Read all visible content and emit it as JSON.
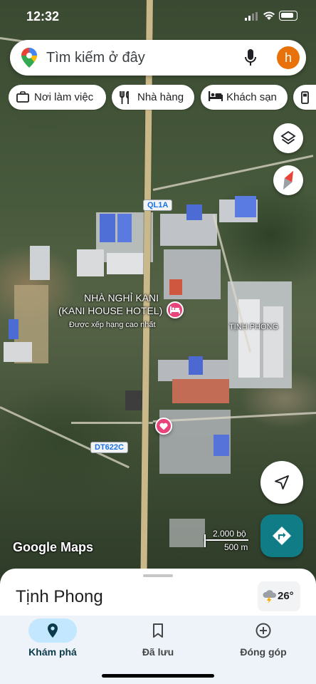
{
  "status_bar": {
    "time": "12:32"
  },
  "search": {
    "placeholder": "Tìm kiếm ở đây",
    "avatar_letter": "h"
  },
  "chips": [
    {
      "label": "Nơi làm việc",
      "icon": "briefcase-icon"
    },
    {
      "label": "Nhà hàng",
      "icon": "restaurant-icon"
    },
    {
      "label": "Khách sạn",
      "icon": "hotel-icon"
    },
    {
      "label": "",
      "icon": "gas-station-icon"
    }
  ],
  "map": {
    "road_shields": {
      "ql1a": "QL1A",
      "dt622c": "DT622C"
    },
    "hotel_name_1": "NHÀ NGHỈ KANI",
    "hotel_name_2": "(KANI HOUSE HOTEL)",
    "hotel_subtitle": "Được xếp hạng cao nhất",
    "area_label": "TỊNH PHONG",
    "google_logo": "Google Maps",
    "scale_imperial": "2.000 bộ",
    "scale_metric": "500 m"
  },
  "sheet": {
    "place_name": "Tịnh Phong",
    "temperature": "26°"
  },
  "nav": {
    "tabs": [
      {
        "label": "Khám phá",
        "icon": "explore-pin-icon",
        "active": true
      },
      {
        "label": "Đã lưu",
        "icon": "bookmark-icon",
        "active": false
      },
      {
        "label": "Đóng góp",
        "icon": "add-circle-icon",
        "active": false
      }
    ]
  },
  "colors": {
    "accent": "#1a73e8",
    "active_pill": "#c2e7ff",
    "avatar": "#e8710a",
    "directions": "#0f7c86",
    "hotel_pin": "#e8437a"
  }
}
